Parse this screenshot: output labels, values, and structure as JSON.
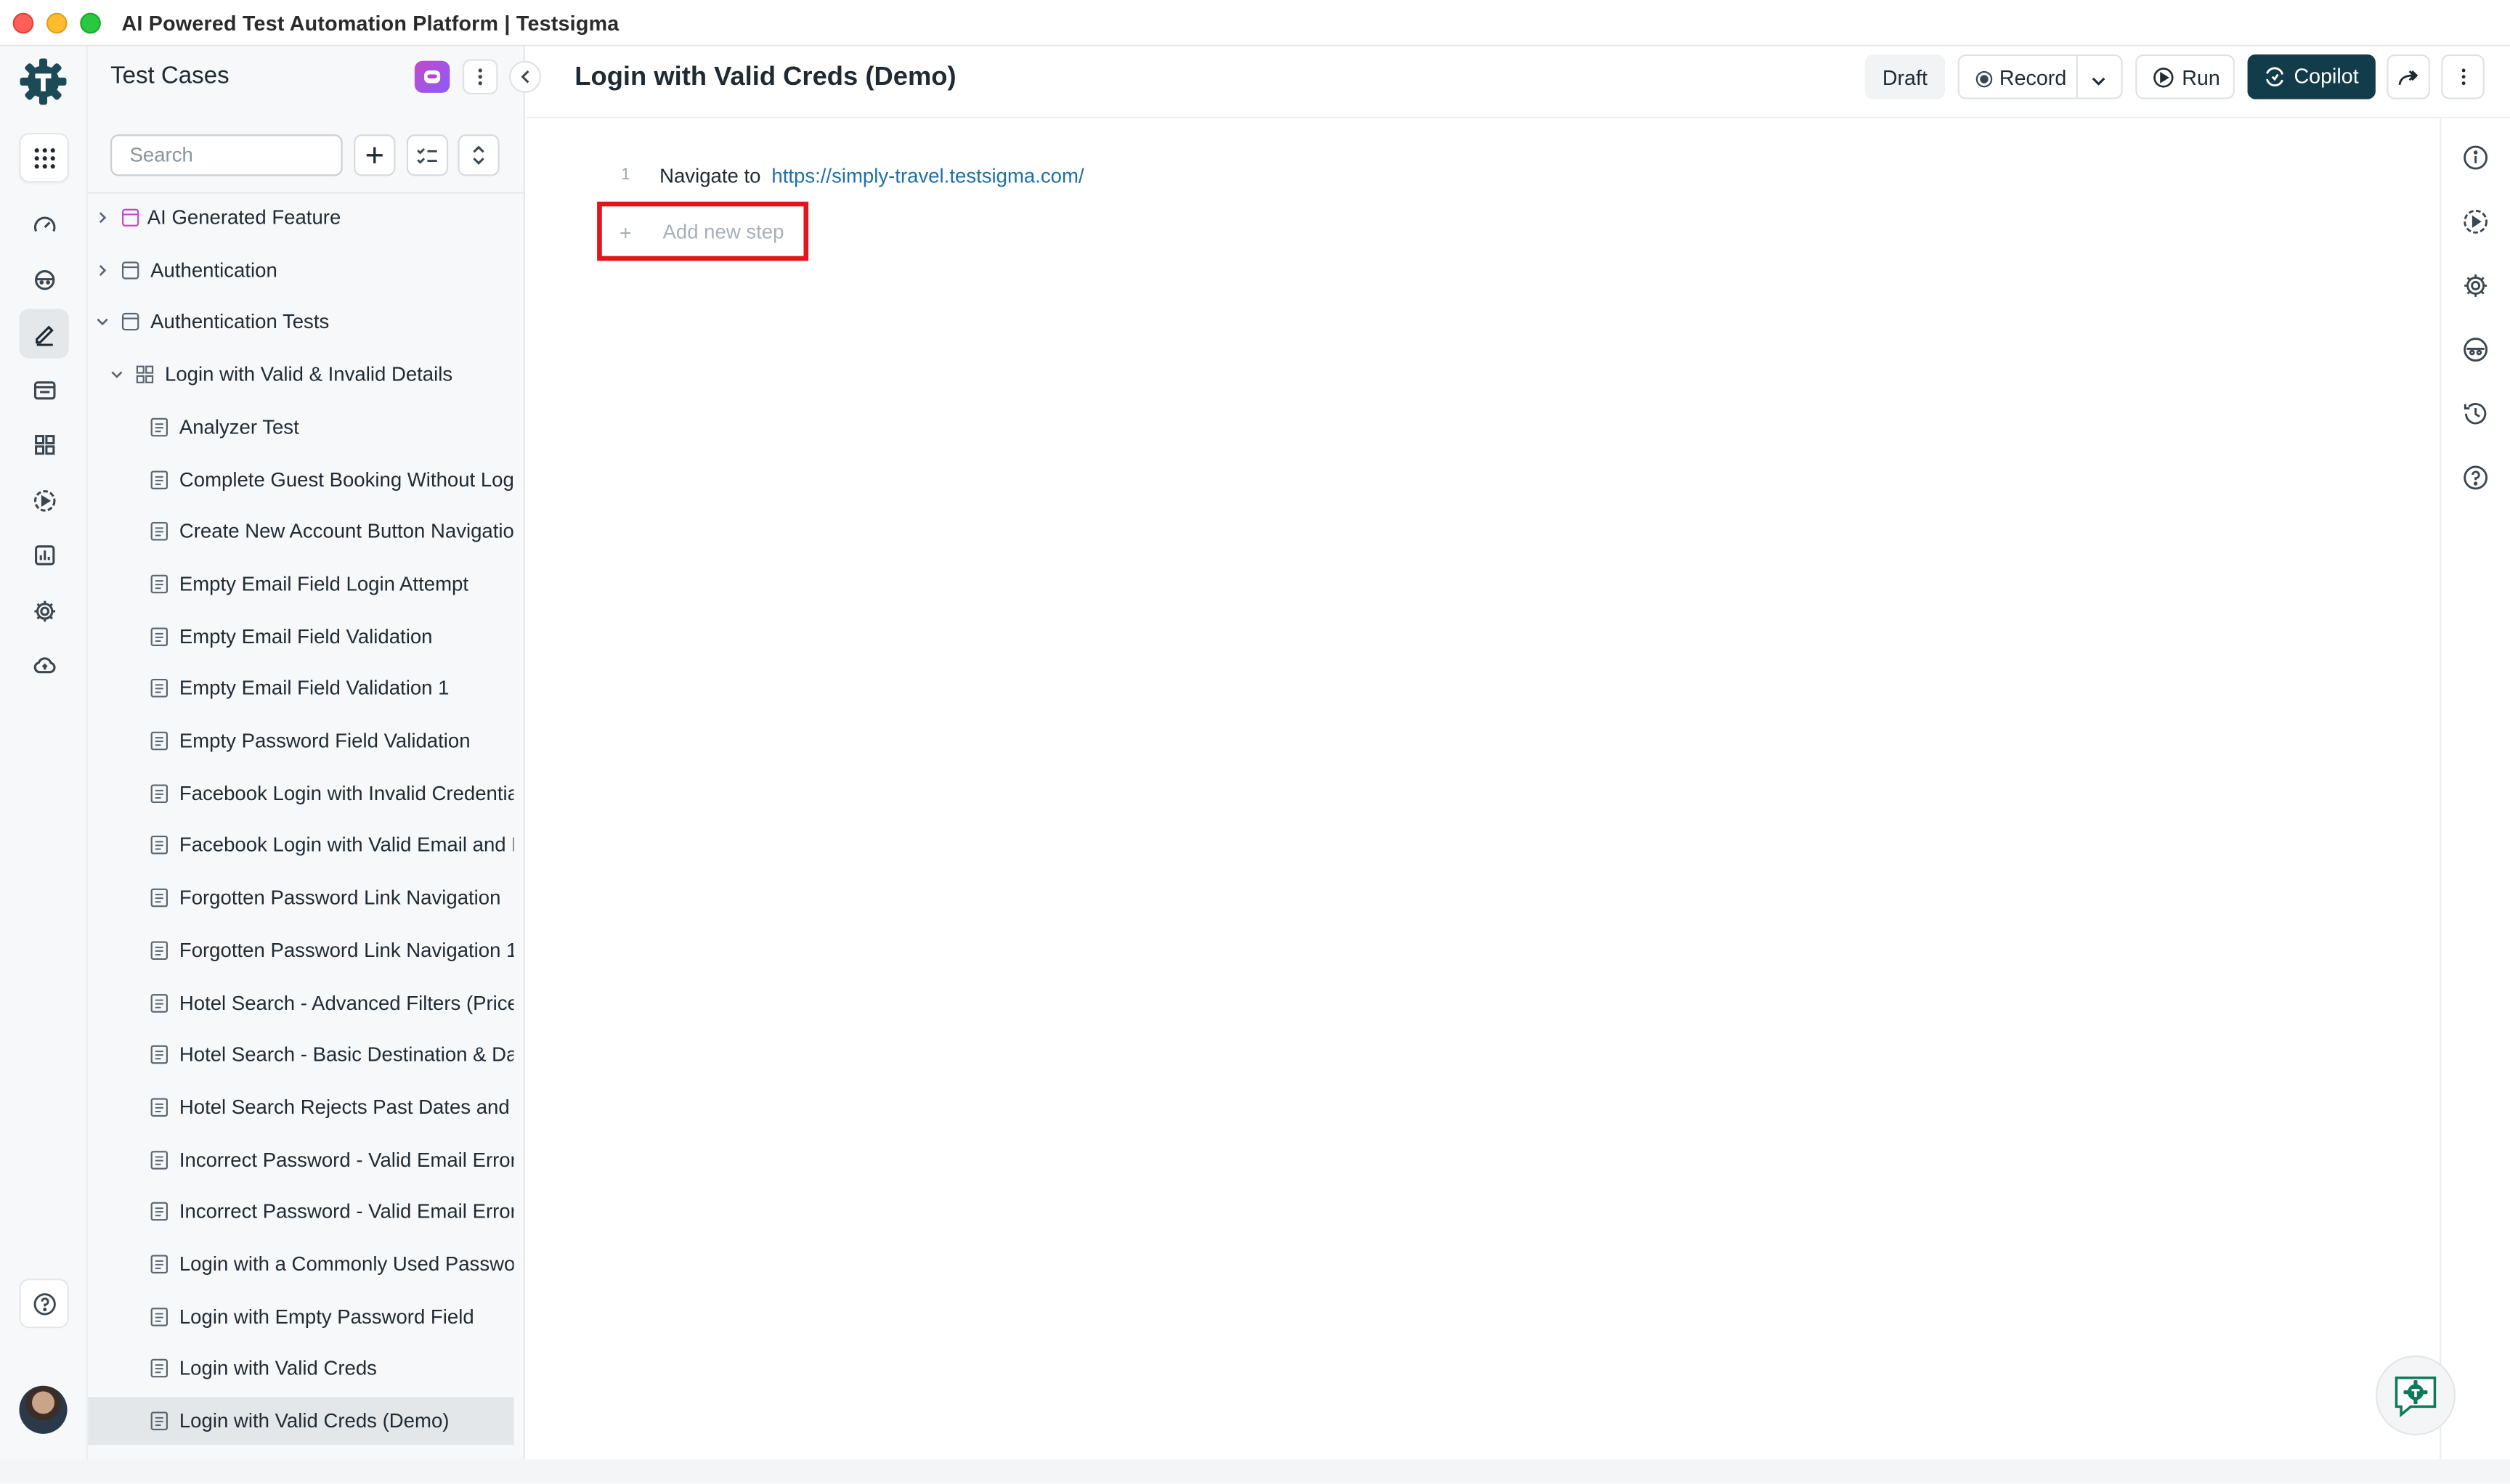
{
  "window": {
    "title": "AI Powered Test Automation Platform | Testsigma"
  },
  "rail": {
    "items": [
      {
        "name": "apps-icon"
      },
      {
        "name": "dashboard-icon"
      },
      {
        "name": "ai-agent-icon"
      },
      {
        "name": "test-cases-icon",
        "active": true
      },
      {
        "name": "test-suites-icon"
      },
      {
        "name": "elements-icon"
      },
      {
        "name": "runs-icon"
      },
      {
        "name": "reports-icon"
      },
      {
        "name": "settings-icon"
      },
      {
        "name": "cloud-icon"
      }
    ],
    "help": "help-icon"
  },
  "panel": {
    "title": "Test Cases",
    "search_placeholder": "Search",
    "tree": [
      {
        "label": "AI Generated Feature",
        "kind": "feature-ai",
        "level": 0,
        "expanded": false
      },
      {
        "label": "Authentication",
        "kind": "feature",
        "level": 0,
        "expanded": false
      },
      {
        "label": "Authentication Tests",
        "kind": "feature",
        "level": 0,
        "expanded": true
      },
      {
        "label": "Login with Valid & Invalid Details",
        "kind": "scenario",
        "level": 1,
        "expanded": true
      },
      {
        "label": "Analyzer Test",
        "kind": "test",
        "level": 2
      },
      {
        "label": "Complete Guest Booking Without Logi",
        "kind": "test",
        "level": 2
      },
      {
        "label": "Create New Account Button Navigatio",
        "kind": "test",
        "level": 2
      },
      {
        "label": "Empty Email Field Login Attempt",
        "kind": "test",
        "level": 2
      },
      {
        "label": "Empty Email Field Validation",
        "kind": "test",
        "level": 2
      },
      {
        "label": "Empty Email Field Validation 1",
        "kind": "test",
        "level": 2
      },
      {
        "label": "Empty Password Field Validation",
        "kind": "test",
        "level": 2
      },
      {
        "label": "Facebook Login with Invalid Credentia",
        "kind": "test",
        "level": 2
      },
      {
        "label": "Facebook Login with Valid Email and P",
        "kind": "test",
        "level": 2
      },
      {
        "label": "Forgotten Password Link Navigation",
        "kind": "test",
        "level": 2
      },
      {
        "label": "Forgotten Password Link Navigation 1",
        "kind": "test",
        "level": 2
      },
      {
        "label": "Hotel Search - Advanced Filters (Price",
        "kind": "test",
        "level": 2
      },
      {
        "label": "Hotel Search - Basic Destination & Da",
        "kind": "test",
        "level": 2
      },
      {
        "label": "Hotel Search Rejects Past Dates and D",
        "kind": "test",
        "level": 2
      },
      {
        "label": "Incorrect Password - Valid Email Error",
        "kind": "test",
        "level": 2
      },
      {
        "label": "Incorrect Password - Valid Email Error",
        "kind": "test",
        "level": 2
      },
      {
        "label": "Login with a Commonly Used Passwor",
        "kind": "test",
        "level": 2
      },
      {
        "label": "Login with Empty Password Field",
        "kind": "test",
        "level": 2
      },
      {
        "label": "Login with Valid Creds",
        "kind": "test",
        "level": 2
      },
      {
        "label": "Login with Valid Creds (Demo)",
        "kind": "test",
        "level": 2,
        "selected": true
      }
    ]
  },
  "header": {
    "title": "Login with Valid Creds (Demo)",
    "draft_label": "Draft",
    "record_label": "Record",
    "run_label": "Run",
    "copilot_label": "Copilot"
  },
  "steps": [
    {
      "number": "1",
      "action": "Navigate to",
      "url": "https://simply-travel.testsigma.com/"
    }
  ],
  "add_step": {
    "label": "Add new step"
  },
  "right_rail": [
    "info-icon",
    "run-settings-icon",
    "gear-icon",
    "visibility-icon",
    "history-icon",
    "help-icon"
  ],
  "colors": {
    "primary": "#123c49",
    "link": "#1f6fa8",
    "highlight": "#e3141b",
    "brand": "#1c4a57"
  }
}
